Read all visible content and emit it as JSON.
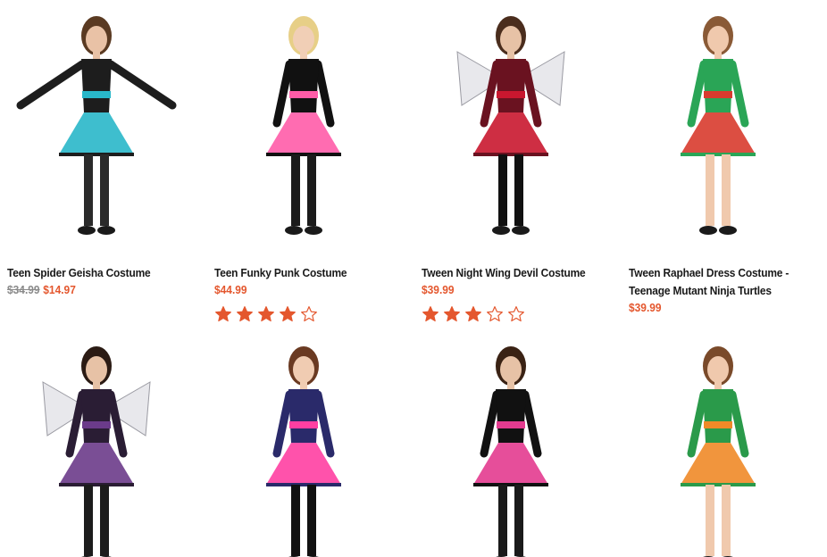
{
  "products": [
    {
      "name": "Teen Spider Geisha Costume",
      "old_price": "$34.99",
      "price": "$14.97",
      "rating": null,
      "palette": {
        "skin": "#e9c2a6",
        "hair": "#5a3a22",
        "main": "#1d1d1d",
        "accent": "#29b7c9",
        "legs": "#2a2a2a"
      }
    },
    {
      "name": "Teen Funky Punk Costume",
      "old_price": "",
      "price": "$44.99",
      "rating": 4,
      "palette": {
        "skin": "#f1cfb6",
        "hair": "#e7cf87",
        "main": "#111111",
        "accent": "#ff5ca8",
        "legs": "#1b1b1b"
      }
    },
    {
      "name": "Tween Night Wing Devil Costume",
      "old_price": "",
      "price": "$39.99",
      "rating": 3,
      "palette": {
        "skin": "#e7c2a6",
        "hair": "#4a2d1d",
        "main": "#6a1220",
        "accent": "#c9172f",
        "legs": "#111111"
      }
    },
    {
      "name": "Tween Raphael Dress Costume - Teenage Mutant Ninja Turtles",
      "old_price": "",
      "price": "$39.99",
      "rating": null,
      "palette": {
        "skin": "#f0c9ad",
        "hair": "#8a5a36",
        "main": "#2aa556",
        "accent": "#d83b2e",
        "legs": "#f0c9ad"
      }
    },
    {
      "palette": {
        "skin": "#e7c2a6",
        "hair": "#2b1b14",
        "main": "#2a1d34",
        "accent": "#6b3b8a",
        "legs": "#1c1c1c"
      }
    },
    {
      "palette": {
        "skin": "#f0ccb2",
        "hair": "#6a3a22",
        "main": "#2a2a6a",
        "accent": "#ff3fa2",
        "legs": "#111111"
      }
    },
    {
      "palette": {
        "skin": "#e7c2a6",
        "hair": "#3a2214",
        "main": "#111111",
        "accent": "#e33b8f",
        "legs": "#1a1a1a"
      }
    },
    {
      "palette": {
        "skin": "#f0c9ad",
        "hair": "#7a4a2a",
        "main": "#2a9a4a",
        "accent": "#f08a28",
        "legs": "#f0c9ad"
      }
    }
  ],
  "colors": {
    "price": "#e4572e",
    "old_price": "#8a8a8a",
    "star": "#e4572e",
    "title": "#1a1a1a"
  }
}
